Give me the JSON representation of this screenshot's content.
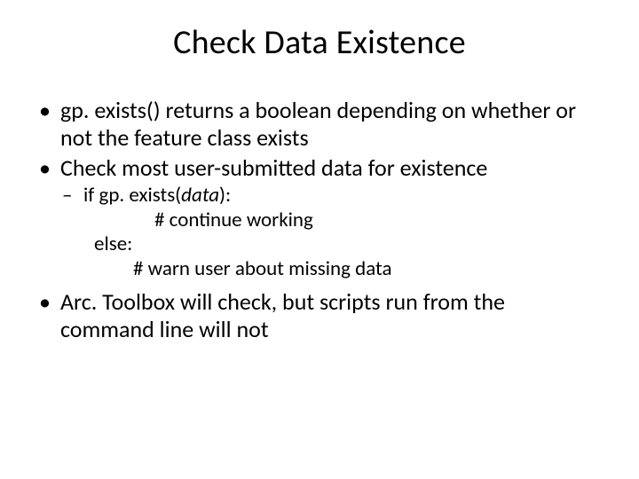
{
  "title": "Check Data Existence",
  "bullets": {
    "b1": "gp. exists() returns a boolean depending on whether or not the feature class exists",
    "b2": "Check most user-submitted data for existence",
    "sub": {
      "line1_pre": "if gp. exists(",
      "line1_arg": "data",
      "line1_post": "):",
      "line2": "# continue working",
      "line3": "else:",
      "line4": "# warn user about missing data"
    },
    "b3": "Arc. Toolbox will check, but scripts run from the command line will not"
  }
}
